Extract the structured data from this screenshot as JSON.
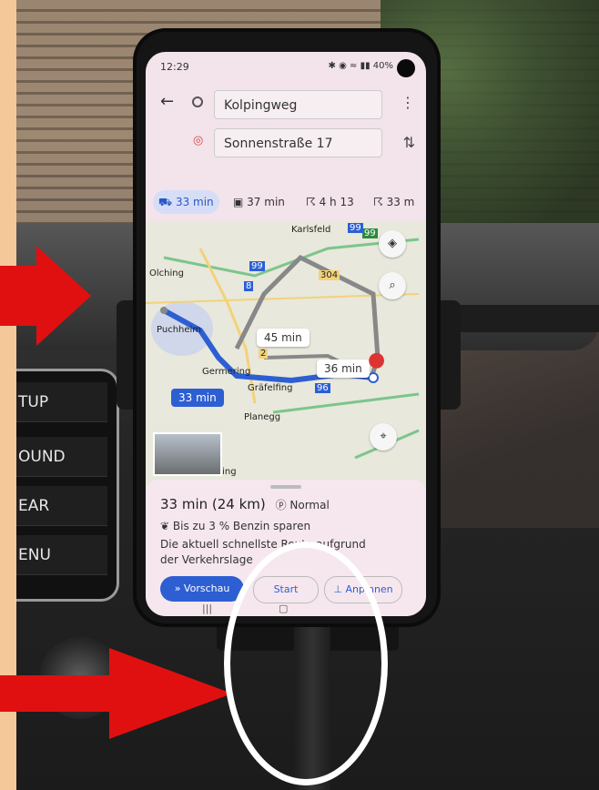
{
  "status": {
    "time": "12:29",
    "battery": "40%"
  },
  "search": {
    "origin": "Kolpingweg",
    "destination": "Sonnenstraße 17"
  },
  "modes": [
    {
      "icon": "car-icon",
      "label": "33 min",
      "active": true
    },
    {
      "icon": "transit-icon",
      "label": "37 min"
    },
    {
      "icon": "walk-icon",
      "label": "4 h 13"
    },
    {
      "icon": "bike-icon",
      "label": "33 m"
    }
  ],
  "map": {
    "labels": [
      "Karlsfeld",
      "Olching",
      "Puchheim",
      "Germering",
      "Gräfelfing",
      "Planegg",
      "Gauting"
    ],
    "road_numbers": [
      "99",
      "304",
      "99",
      "8",
      "2",
      "96",
      "99"
    ],
    "route_chips": [
      "33 min",
      "45 min",
      "36 min"
    ]
  },
  "sheet": {
    "summary": "33 min (24 km)",
    "traffic": "Normal",
    "fuel": "Bis zu 3 % Benzin sparen",
    "description": "Die aktuell schnellste Route aufgrund der Verkehrslage",
    "preview_label": "Vorschau",
    "start_label": "Start",
    "pin_label": "Anpinnen"
  },
  "console": [
    "TUP",
    "OUND",
    "EAR",
    "ENU"
  ],
  "colors": {
    "frame": "#f5c89a",
    "route": "#2d5fd3",
    "arrow": "#e01010",
    "annotation_ellipse": "#ffffff"
  }
}
